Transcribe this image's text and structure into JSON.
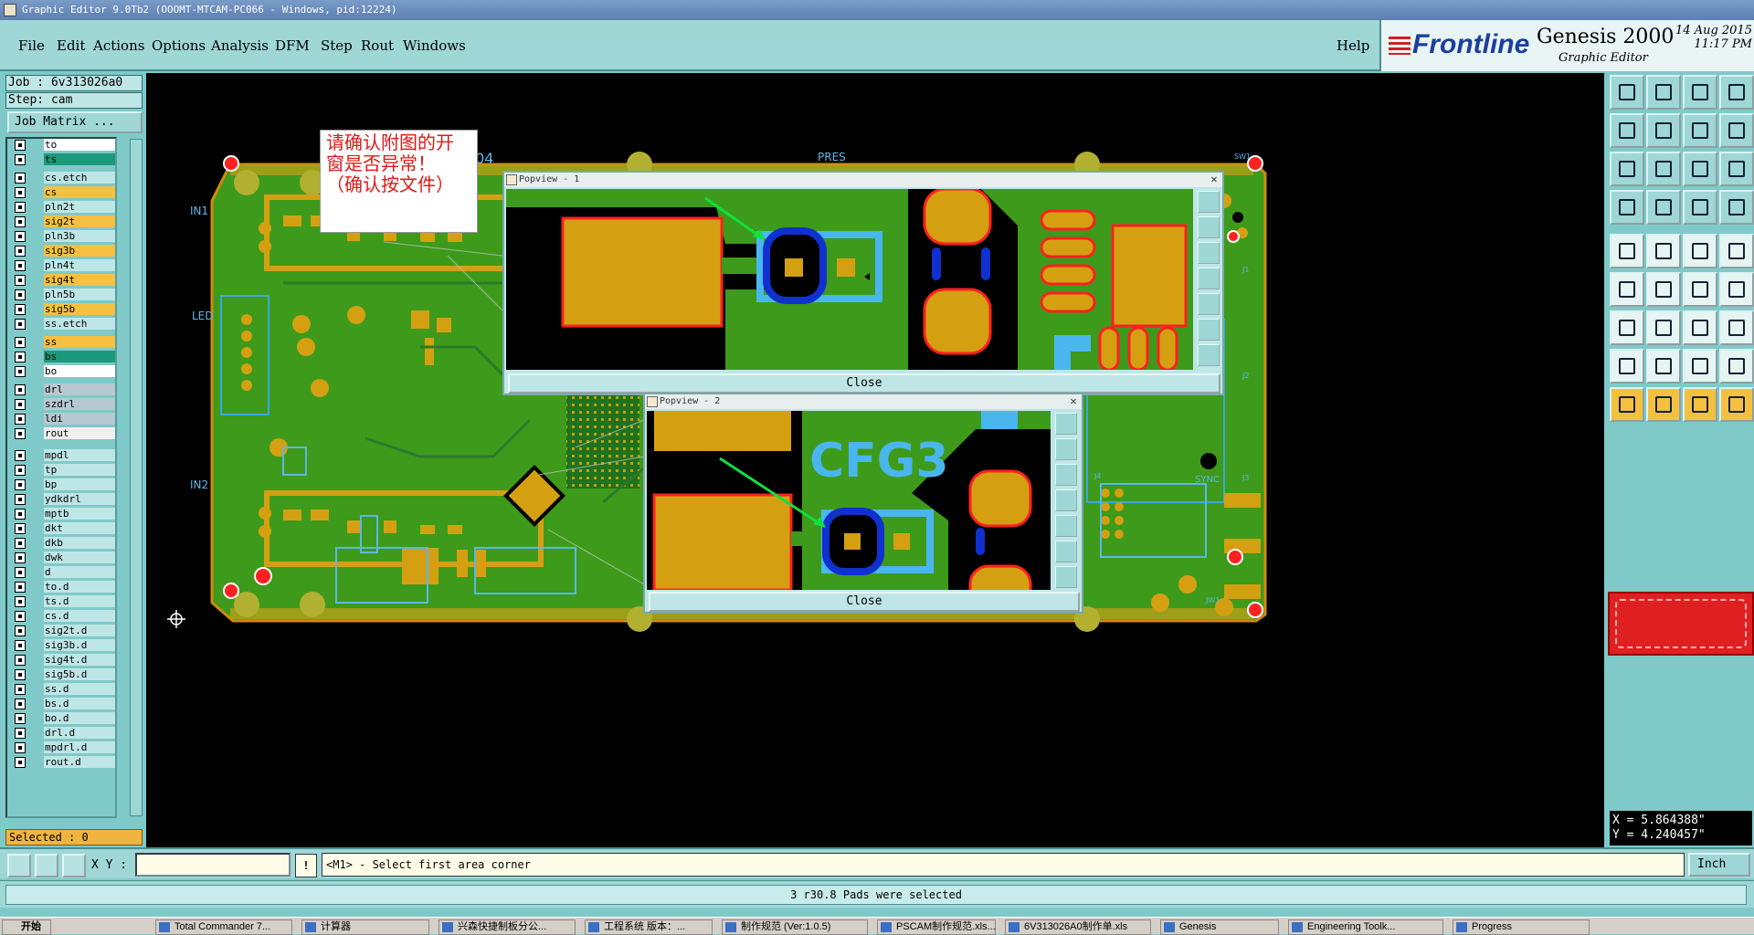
{
  "window": {
    "title": "Graphic Editor 9.0Tb2 (OOOMT-MTCAM-PC066 - Windows, pid:12224)"
  },
  "menu": {
    "items": [
      "File",
      "Edit",
      "Actions",
      "Options",
      "Analysis",
      "DFM",
      "Step",
      "Rout",
      "Windows"
    ],
    "help": "Help"
  },
  "logo": {
    "brand": "Frontline",
    "product": "Genesis 2000",
    "subtitle": "Graphic Editor",
    "date": "14 Aug 2015",
    "time": "11:17 PM"
  },
  "job": {
    "job_label": "Job : 6v313026a0",
    "step_label": "Step: cam",
    "matrix_button": "Job Matrix ..."
  },
  "layers": [
    {
      "name": "to",
      "color": "#ffffff"
    },
    {
      "name": "ts",
      "color": "#1a9a7a"
    },
    {
      "name": "cs.etch",
      "color": "#bfe6e6"
    },
    {
      "name": "cs",
      "color": "#f5c040"
    },
    {
      "name": "pln2t",
      "color": "#bfe6e6"
    },
    {
      "name": "sig2t",
      "color": "#f5c040"
    },
    {
      "name": "pln3b",
      "color": "#bfe6e6"
    },
    {
      "name": "sig3b",
      "color": "#f5c040"
    },
    {
      "name": "pln4t",
      "color": "#bfe6e6"
    },
    {
      "name": "sig4t",
      "color": "#f5c040"
    },
    {
      "name": "pln5b",
      "color": "#bfe6e6"
    },
    {
      "name": "sig5b",
      "color": "#f5c040"
    },
    {
      "name": "ss.etch",
      "color": "#bfe6e6"
    },
    {
      "name": "ss",
      "color": "#f5c040"
    },
    {
      "name": "bs",
      "color": "#1a9a7a"
    },
    {
      "name": "bo",
      "color": "#ffffff"
    },
    {
      "name": "drl",
      "color": "#b8c8d0"
    },
    {
      "name": "szdrl",
      "color": "#b8c8d0"
    },
    {
      "name": "ldi",
      "color": "#b8c8d0"
    },
    {
      "name": "rout",
      "color": "#f0f0f0"
    },
    {
      "name": "mpdl",
      "color": "#bfe6e6"
    },
    {
      "name": "tp",
      "color": "#bfe6e6"
    },
    {
      "name": "bp",
      "color": "#bfe6e6"
    },
    {
      "name": "ydkdrl",
      "color": "#bfe6e6"
    },
    {
      "name": "mptb",
      "color": "#bfe6e6"
    },
    {
      "name": "dkt",
      "color": "#bfe6e6"
    },
    {
      "name": "dkb",
      "color": "#bfe6e6"
    },
    {
      "name": "dwk",
      "color": "#bfe6e6"
    },
    {
      "name": "d",
      "color": "#bfe6e6"
    },
    {
      "name": "to.d",
      "color": "#bfe6e6"
    },
    {
      "name": "ts.d",
      "color": "#bfe6e6"
    },
    {
      "name": "cs.d",
      "color": "#bfe6e6"
    },
    {
      "name": "sig2t.d",
      "color": "#bfe6e6"
    },
    {
      "name": "sig3b.d",
      "color": "#bfe6e6"
    },
    {
      "name": "sig4t.d",
      "color": "#bfe6e6"
    },
    {
      "name": "sig5b.d",
      "color": "#bfe6e6"
    },
    {
      "name": "ss.d",
      "color": "#bfe6e6"
    },
    {
      "name": "bs.d",
      "color": "#bfe6e6"
    },
    {
      "name": "bo.d",
      "color": "#bfe6e6"
    },
    {
      "name": "drl.d",
      "color": "#bfe6e6"
    },
    {
      "name": "mpdrl.d",
      "color": "#bfe6e6"
    },
    {
      "name": "rout.d",
      "color": "#bfe6e6"
    }
  ],
  "selected": "Selected : 0",
  "annotation": "请确认附图的开窗是否异常！（确认按文件）",
  "board": {
    "labels": [
      "IN1",
      "IN2",
      "LED",
      "PRES",
      "SW1",
      "J1",
      "J2",
      "J3",
      "J4",
      "SYNC",
      "JW1",
      "D104.804",
      "N:"
    ]
  },
  "popup1": {
    "title": "Popview - 1",
    "close": "Close"
  },
  "popup2": {
    "title": "Popview - 2",
    "close": "Close",
    "label": "CFG3"
  },
  "coords": {
    "x": "X = 5.864388\"",
    "y": "Y = 4.240457\""
  },
  "toolbar_bottom": {
    "xy_label": "X Y :",
    "xy_value": "",
    "bang": "!",
    "prompt": "<M1> - Select first area corner",
    "unit": "Inch"
  },
  "status": "3 r30.8 Pads were selected",
  "taskbar": {
    "start": "开始",
    "tasks": [
      "Total Commander 7...",
      "计算器",
      "兴森快捷制板分公...",
      "工程系统 版本：...",
      "制作规范 (Ver:1.0.5)",
      "PSCAM制作规范.xls...",
      "6V313026A0制作单.xls",
      "Genesis",
      "Engineering Toolk...",
      "Progress"
    ]
  }
}
